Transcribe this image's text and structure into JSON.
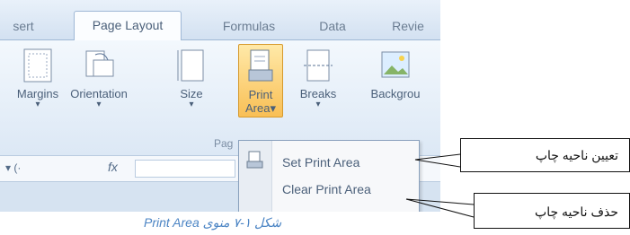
{
  "ribbon": {
    "tabs": [
      {
        "label": "sert",
        "active": false
      },
      {
        "label": "Page Layout",
        "active": true
      },
      {
        "label": "Formulas",
        "active": false
      },
      {
        "label": "Data",
        "active": false
      },
      {
        "label": "Revie",
        "active": false
      }
    ],
    "buttons": {
      "margins": "Margins",
      "orientation": "Orientation",
      "size": "Size",
      "print_area_line1": "Print",
      "print_area_line2": "Area",
      "breaks": "Breaks",
      "background": "Backgrou"
    },
    "group_label": "Pag"
  },
  "formula_bar": {
    "fx": "fx"
  },
  "print_area_menu": {
    "items": [
      {
        "label": "Set Print Area"
      },
      {
        "label": "Clear Print Area"
      }
    ]
  },
  "callouts": {
    "set": "تعیین ناحیه چاپ",
    "clear": "حذف ناحیه چاپ"
  },
  "caption": "شکل ۱-۷ منوی Print Area"
}
